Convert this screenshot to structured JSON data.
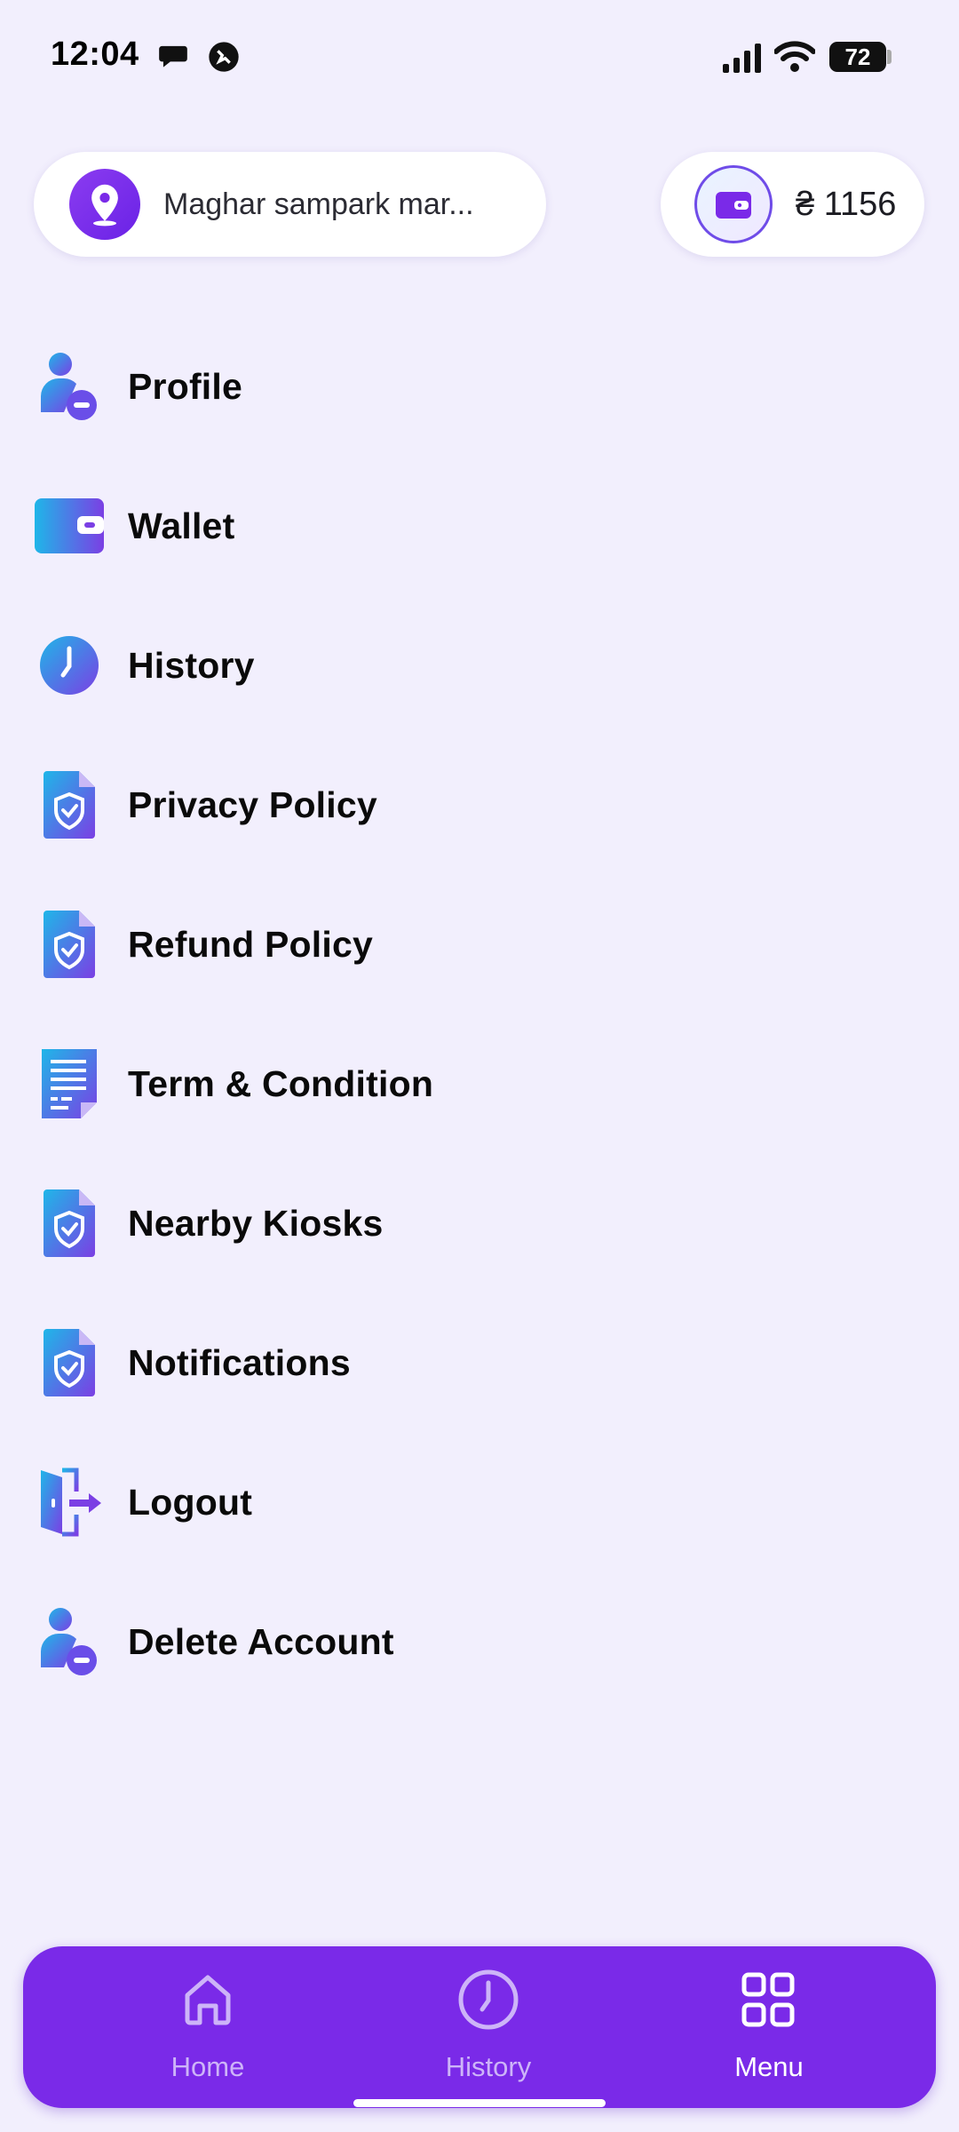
{
  "status_bar": {
    "time": "12:04",
    "battery": "72"
  },
  "header": {
    "location": "Maghar sampark mar...",
    "wallet_balance": "₴ 1156"
  },
  "menu": {
    "items": [
      {
        "label": "Profile",
        "icon": "user-minus-icon"
      },
      {
        "label": "Wallet",
        "icon": "wallet-icon"
      },
      {
        "label": "History",
        "icon": "clock-icon"
      },
      {
        "label": "Privacy Policy",
        "icon": "shield-document-icon"
      },
      {
        "label": "Refund Policy",
        "icon": "shield-document-icon"
      },
      {
        "label": "Term & Condition",
        "icon": "document-lines-icon"
      },
      {
        "label": "Nearby Kiosks",
        "icon": "shield-document-icon"
      },
      {
        "label": "Notifications",
        "icon": "shield-document-icon"
      },
      {
        "label": "Logout",
        "icon": "logout-door-icon"
      },
      {
        "label": "Delete Account",
        "icon": "user-minus-icon"
      }
    ]
  },
  "bottom_nav": {
    "items": [
      {
        "label": "Home",
        "icon": "home-icon",
        "active": false
      },
      {
        "label": "History",
        "icon": "clock-icon",
        "active": false
      },
      {
        "label": "Menu",
        "icon": "grid-menu-icon",
        "active": true
      }
    ]
  },
  "colors": {
    "background": "#f2effd",
    "accent": "#7a2ae8",
    "icon_gradient_start": "#1fb6e8",
    "icon_gradient_end": "#7b3fe4"
  }
}
